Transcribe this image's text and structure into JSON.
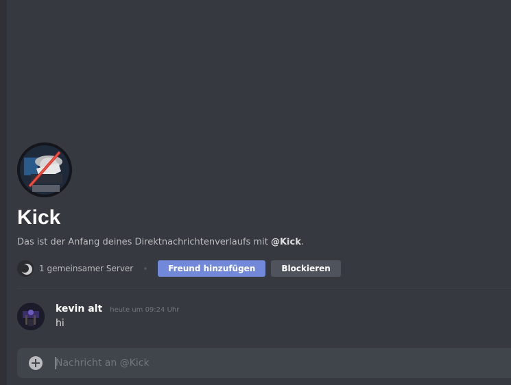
{
  "dm": {
    "title": "Kick",
    "intro_prefix": "Das ist der Anfang deines Direktnachrichtenverlaufs mit ",
    "intro_mention": "@Kick",
    "intro_suffix": ".",
    "mutual_servers": "1 gemeinsamer Server",
    "add_friend_label": "Freund hinzufügen",
    "block_label": "Blockieren"
  },
  "messages": [
    {
      "author": "kevin alt",
      "timestamp": "heute um 09:24 Uhr",
      "content": "hi"
    }
  ],
  "composer": {
    "placeholder": "Nachricht an @Kick",
    "attach_icon": "plus-circle-icon"
  },
  "colors": {
    "background": "#36393f",
    "primary_button": "#7289da",
    "secondary_button": "#4f545c",
    "composer_bg": "#40444b"
  }
}
